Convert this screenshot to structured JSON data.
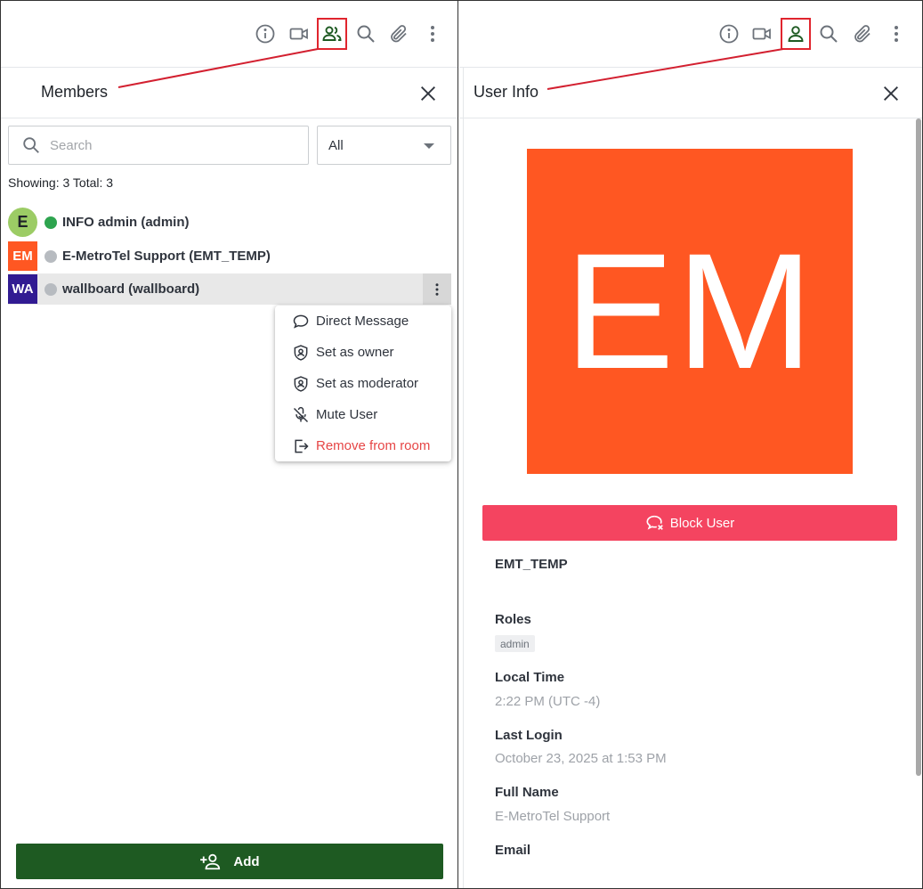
{
  "colors": {
    "accent_green": "#1e5a22",
    "highlight_red": "#e0252e",
    "block_red": "#f44460",
    "avatar_em": "#ff5722",
    "avatar_wa": "#311b92",
    "avatar_e": "#9ccc65",
    "online": "#2ea44f",
    "offline": "#b7bbc0"
  },
  "toolbar_icons": [
    "info-icon",
    "video-icon",
    "members-icon",
    "search-icon",
    "attachment-icon",
    "kebab-icon"
  ],
  "members_panel": {
    "title": "Members",
    "search_placeholder": "Search",
    "filter_value": "All",
    "showing_text": "Showing: 3 Total: 3",
    "members": [
      {
        "initials": "E",
        "name": "INFO admin (admin)",
        "status": "online"
      },
      {
        "initials": "EM",
        "name": "E-MetroTel Support (EMT_TEMP)",
        "status": "offline"
      },
      {
        "initials": "WA",
        "name": "wallboard (wallboard)",
        "status": "offline"
      }
    ],
    "menu": [
      {
        "label": "Direct Message",
        "icon": "chat-bubble-icon"
      },
      {
        "label": "Set as owner",
        "icon": "shield-user-icon"
      },
      {
        "label": "Set as moderator",
        "icon": "shield-user-icon"
      },
      {
        "label": "Mute User",
        "icon": "mic-off-icon"
      },
      {
        "label": "Remove from room",
        "icon": "sign-out-icon"
      }
    ],
    "add_label": "Add"
  },
  "user_info": {
    "title": "User Info",
    "avatar_initials": "EM",
    "block_label": "Block User",
    "username": "EMT_TEMP",
    "roles_label": "Roles",
    "roles": [
      "admin"
    ],
    "local_time_label": "Local Time",
    "local_time_value": "2:22 PM (UTC -4)",
    "last_login_label": "Last Login",
    "last_login_value": "October 23, 2025 at 1:53 PM",
    "full_name_label": "Full Name",
    "full_name_value": "E-MetroTel Support",
    "email_label": "Email"
  }
}
